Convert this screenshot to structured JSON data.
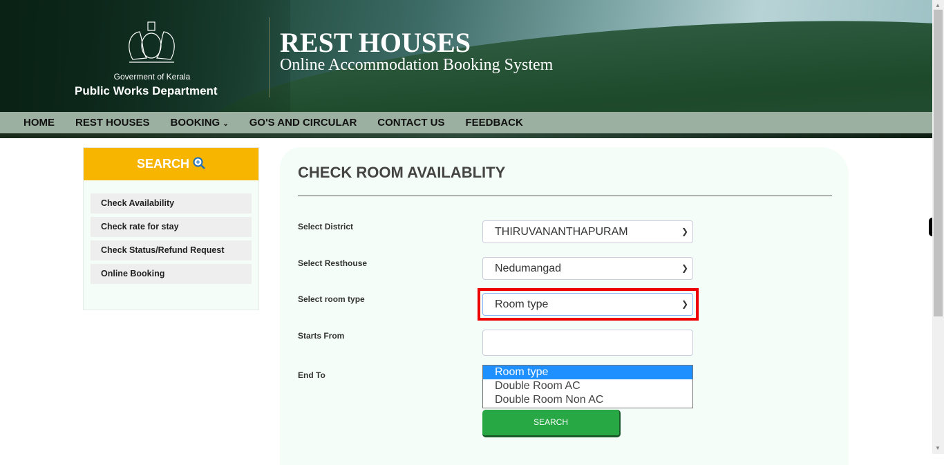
{
  "header": {
    "gov": "Goverment of Kerala",
    "dept": "Public Works Department",
    "title": "REST HOUSES",
    "subtitle": "Online Accommodation Booking System"
  },
  "nav": [
    "HOME",
    "REST HOUSES",
    "BOOKING",
    "GO'S AND CIRCULAR",
    "CONTACT US",
    "FEEDBACK"
  ],
  "sidebar": {
    "title": "SEARCH",
    "items": [
      "Check Availability",
      "Check rate for stay",
      "Check Status/Refund Request",
      "Online Booking"
    ]
  },
  "main": {
    "title": "CHECK ROOM AVAILABLITY",
    "labels": {
      "district": "Select District",
      "resthouse": "Select Resthouse",
      "roomtype": "Select room type",
      "start": "Starts From",
      "end": "End To"
    },
    "district": "THIRUVANANTHAPURAM",
    "resthouse": "Nedumangad",
    "roomtype": "Room type",
    "options": [
      "Room type",
      "Double Room AC",
      "Double Room Non AC"
    ],
    "search_label": "SEARCH"
  },
  "colors": {
    "accent": "#f8b500",
    "button": "#28a745",
    "highlight": "#ee0000",
    "nav": "#9bb0a0"
  }
}
